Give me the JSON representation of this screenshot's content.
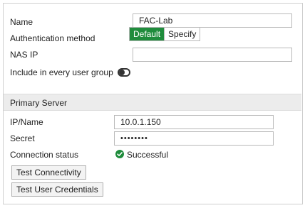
{
  "form": {
    "name_label": "Name",
    "name_value": "FAC-Lab",
    "auth_label": "Authentication method",
    "auth_options": [
      "Default",
      "Specify"
    ],
    "auth_selected": "Default",
    "nas_ip_label": "NAS IP",
    "nas_ip_value": "",
    "include_group_label": "Include in every user group",
    "include_group_enabled": false
  },
  "primary_server": {
    "section_title": "Primary Server",
    "ip_label": "IP/Name",
    "ip_value": "10.0.1.150",
    "secret_label": "Secret",
    "secret_value": "••••••••",
    "status_label": "Connection status",
    "status_value": "Successful",
    "status_color": "#1f8c3c",
    "status_icon": "check-circle-icon",
    "test_connectivity_label": "Test Connectivity",
    "test_credentials_label": "Test User Credentials"
  }
}
